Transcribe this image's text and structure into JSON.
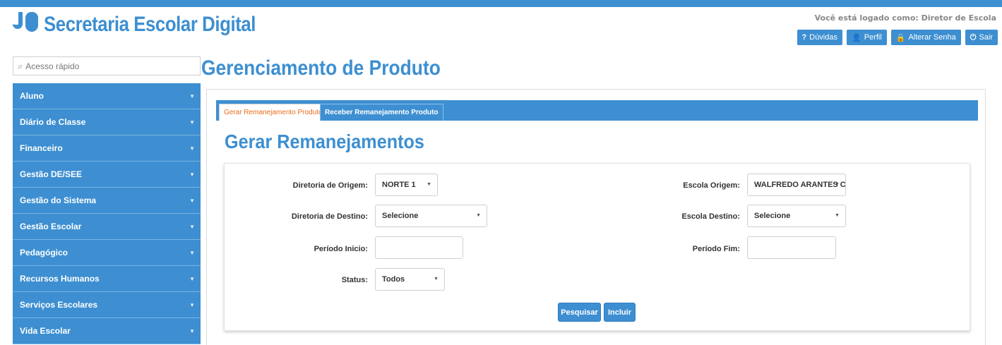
{
  "app": {
    "title": "Secretaria Escolar Digital",
    "logged_as": "Você está logado como: Diretor de Escola",
    "brand_color": "#3d8fd1"
  },
  "top_actions": [
    {
      "icon": "question-icon",
      "glyph": "?",
      "label": "Dúvidas"
    },
    {
      "icon": "user-icon",
      "glyph": "👤",
      "label": "Perfil"
    },
    {
      "icon": "lock-icon",
      "glyph": "🔒",
      "label": "Alterar Senha"
    },
    {
      "icon": "power-icon",
      "glyph": "⏻",
      "label": "Sair"
    }
  ],
  "quick_access": {
    "placeholder": "Acesso rápido"
  },
  "page_title": "Gerenciamento de Produto",
  "sidebar": {
    "items": [
      {
        "label": "Aluno"
      },
      {
        "label": "Diário de Classe"
      },
      {
        "label": "Financeiro"
      },
      {
        "label": "Gestão DE/SEE"
      },
      {
        "label": "Gestão do Sistema"
      },
      {
        "label": "Gestão Escolar"
      },
      {
        "label": "Pedagógico"
      },
      {
        "label": "Recursos Humanos"
      },
      {
        "label": "Serviços Escolares"
      },
      {
        "label": "Vida Escolar"
      }
    ]
  },
  "tabs": [
    {
      "label": "Gerar Remanejamento Produto",
      "active": true
    },
    {
      "label": "Receber Remanejamento Produto",
      "active": false
    }
  ],
  "section_title": "Gerar Remanejamentos",
  "form": {
    "diretoria_origem": {
      "label": "Diretoria de Origem:",
      "value": "NORTE 1"
    },
    "escola_origem": {
      "label": "Escola Origem:",
      "value": "WALFREDO ARANTES CALI"
    },
    "diretoria_destino": {
      "label": "Diretoria de Destino:",
      "value": "Selecione"
    },
    "escola_destino": {
      "label": "Escola Destino:",
      "value": "Selecione"
    },
    "periodo_inicio": {
      "label": "Período Inicio:",
      "value": ""
    },
    "periodo_fim": {
      "label": "Período Fim:",
      "value": ""
    },
    "status": {
      "label": "Status:",
      "value": "Todos"
    },
    "search_label": "Pesquisar",
    "include_label": "Incluir"
  }
}
